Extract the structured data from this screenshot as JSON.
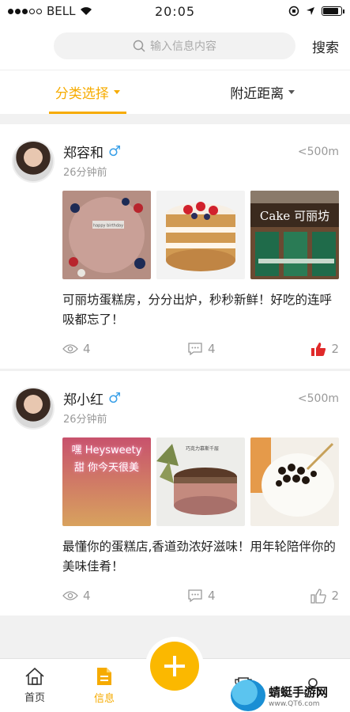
{
  "status_bar": {
    "carrier": "BELL",
    "time": "20:05"
  },
  "search": {
    "placeholder": "输入信息内容",
    "button_label": "搜索"
  },
  "tabs": [
    {
      "label": "分类选择",
      "active": true
    },
    {
      "label": "附近距离",
      "active": false
    }
  ],
  "posts": [
    {
      "name": "郑容和",
      "gender_symbol": "♂",
      "time": "26分钟前",
      "distance": "<500m",
      "text": "可丽坊蛋糕房，分分出炉，秒秒新鲜！好吃的连呼吸都忘了！",
      "photo_captions": [
        "happy birthday",
        "",
        "Cake 可丽坊"
      ],
      "views": "4",
      "comments": "4",
      "likes": "2",
      "liked": true
    },
    {
      "name": "郑小红",
      "gender_symbol": "♂",
      "time": "26分钟前",
      "distance": "<500m",
      "text": "最懂你的蛋糕店,香道劲浓好滋味！用年轮陪伴你的美味佳肴！",
      "photo_captions": [
        "嘿 Heysweety 甜 你今天很美",
        "巧克力慕斯千层",
        ""
      ],
      "views": "4",
      "comments": "4",
      "likes": "2",
      "liked": false
    }
  ],
  "bottom_nav": [
    {
      "label": "首页",
      "icon": "home-icon",
      "active": false
    },
    {
      "label": "信息",
      "icon": "document-icon",
      "active": true
    },
    {
      "label": "",
      "icon": "plus-icon",
      "active": false
    },
    {
      "label": "",
      "icon": "trophy-icon",
      "active": false
    },
    {
      "label": "",
      "icon": "user-icon",
      "active": false
    }
  ],
  "watermark": {
    "title": "蜻蜓手游网",
    "url": "www.QT6.com"
  },
  "colors": {
    "accent": "#f6ab00",
    "male": "#3aa0e8",
    "like": "#e0292a"
  }
}
